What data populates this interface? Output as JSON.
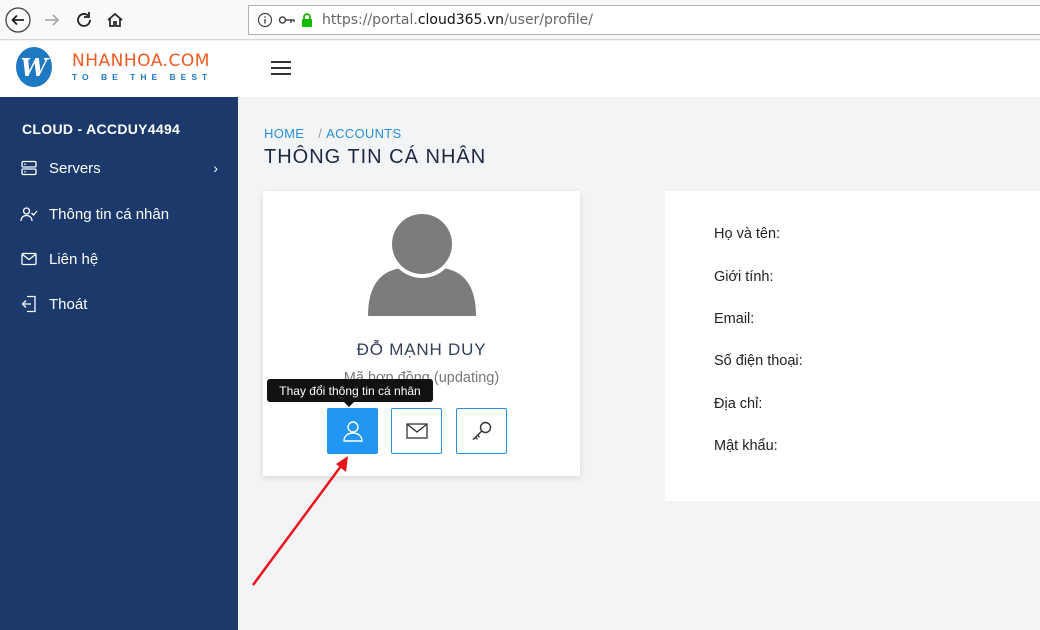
{
  "browser": {
    "url_prefix": "https://portal.",
    "url_host": "cloud365.vn",
    "url_path": "/user/profile/"
  },
  "header": {
    "logo_letter": "W",
    "logo_name": "NHANHOA.COM",
    "logo_tagline": "TO BE THE BEST"
  },
  "sidebar": {
    "account": "CLOUD - ACCDUY4494",
    "items": [
      {
        "label": "Servers",
        "icon": "server-icon"
      },
      {
        "label": "Thông tin cá nhân",
        "icon": "user-check-icon"
      },
      {
        "label": "Liên hệ",
        "icon": "mail-icon"
      },
      {
        "label": "Thoát",
        "icon": "logout-icon"
      }
    ]
  },
  "breadcrumb": {
    "home": "HOME",
    "sep": "/",
    "current": "ACCOUNTS"
  },
  "page_title": "THÔNG TIN CÁ NHÂN",
  "profile": {
    "name": "ĐỖ MẠNH DUY",
    "contract": "Mã hợp đồng (updating)",
    "tooltip": "Thay đổi thông tin cá nhân"
  },
  "info": {
    "labels": [
      "Họ và tên:",
      "Giới tính:",
      "Email:",
      "Số điện thoại:",
      "Địa chỉ:",
      "Mật khẩu:"
    ]
  },
  "colors": {
    "sidebar": "#1b3a6b",
    "accent": "#2196f3",
    "logo_orange": "#f05a22",
    "annotation_arrow": "#e8141b"
  }
}
